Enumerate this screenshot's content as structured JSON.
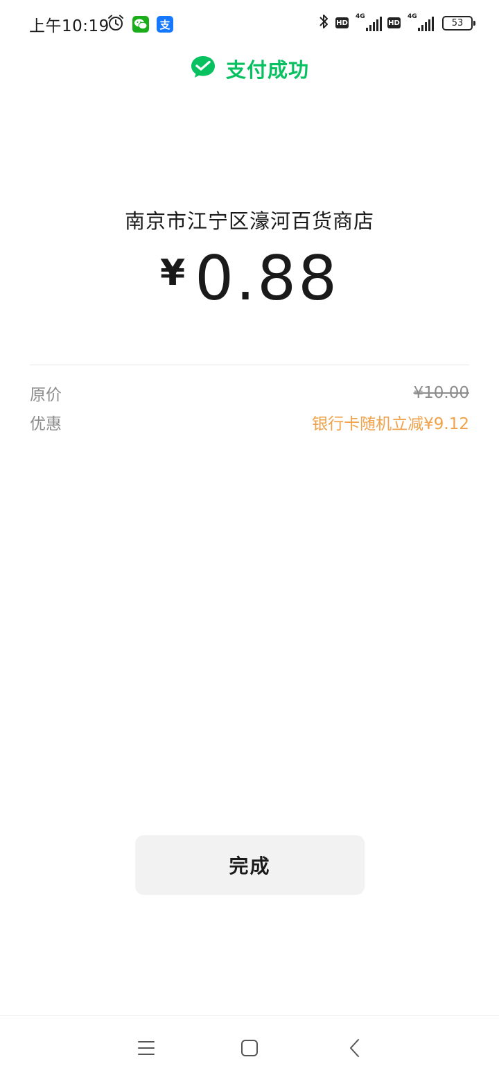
{
  "status_bar": {
    "time": "上午10:19",
    "alipay_badge_text": "支",
    "hd_label_1": "HD",
    "hd_label_2": "HD",
    "network_label_1": "4G",
    "network_label_2": "4G",
    "battery_level": "53",
    "icons": [
      "alarm-clock-icon",
      "wechat-notification-icon",
      "alipay-notification-icon",
      "bluetooth-icon",
      "signal-icon",
      "battery-icon"
    ]
  },
  "header": {
    "title": "支付成功",
    "icon": "wechat-pay-check-icon",
    "accent_color": "#07c160"
  },
  "payment": {
    "merchant": "南京市江宁区濠河百货商店",
    "currency_symbol": "¥",
    "amount": "0.88"
  },
  "details": [
    {
      "label": "原价",
      "value": "¥10.00"
    },
    {
      "label": "优惠",
      "value": "银行卡随机立减¥9.12"
    }
  ],
  "colors": {
    "discount": "#f0a24a",
    "label": "#8c8c8c",
    "button_bg": "#f2f2f2"
  },
  "actions": {
    "done_label": "完成"
  },
  "nav_bar": {
    "icons": [
      "menu-icon",
      "home-square-icon",
      "back-chevron-icon"
    ]
  }
}
